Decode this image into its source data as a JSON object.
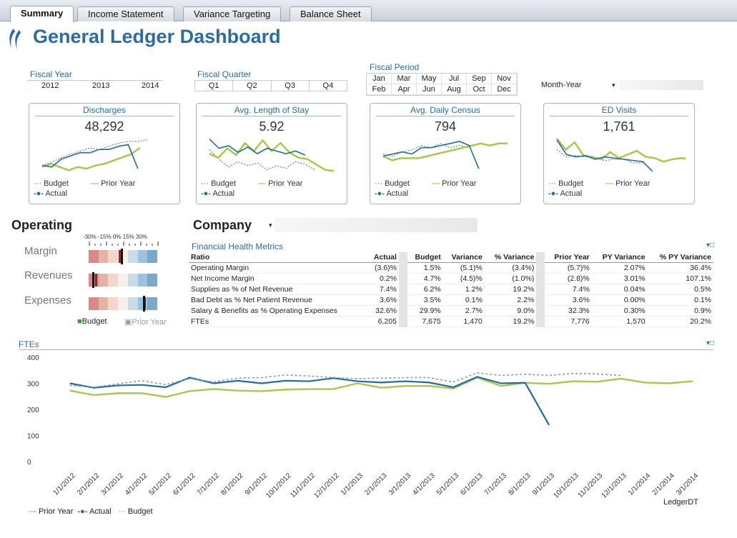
{
  "tabs": [
    {
      "label": "Summary",
      "active": true
    },
    {
      "label": "Income Statement"
    },
    {
      "label": "Variance Targeting"
    },
    {
      "label": "Balance Sheet"
    }
  ],
  "header": {
    "title": "General Ledger Dashboard",
    "accent": "#2b6ca3"
  },
  "filters": {
    "fiscal_year": {
      "label": "Fiscal Year",
      "values": [
        "2012",
        "2013",
        "2014"
      ]
    },
    "fiscal_quarter": {
      "label": "Fiscal Quarter",
      "values": [
        "Q1",
        "Q2",
        "Q3",
        "Q4"
      ]
    },
    "fiscal_period": {
      "label": "Fiscal Period",
      "values": [
        "Jan",
        "Mar",
        "May",
        "Jul",
        "Sep",
        "Nov",
        "Feb",
        "Apr",
        "Jun",
        "Aug",
        "Oct",
        "Dec"
      ]
    },
    "month_year": {
      "label": "Month-Year"
    }
  },
  "kpis": [
    {
      "title": "Discharges",
      "value": "48,292",
      "chart_data": {
        "type": "line",
        "series": [
          {
            "name": "Budget",
            "values": [
              4.1,
              4.3,
              4.6,
              4.8,
              5.0,
              5.2,
              5.1,
              5.3,
              5.5,
              5.6,
              5.6,
              5.7
            ]
          },
          {
            "name": "Prior Year",
            "values": [
              4.0,
              4.2,
              4.0,
              3.8,
              4.0,
              3.9,
              4.1,
              4.2,
              4.4,
              4.6,
              4.8,
              5.2
            ]
          },
          {
            "name": "Actual",
            "values": [
              4.1,
              4.0,
              4.5,
              4.7,
              4.9,
              4.9,
              5.1,
              5.1,
              5.3,
              5.4,
              3.9
            ]
          }
        ]
      }
    },
    {
      "title": "Avg. Length of Stay",
      "value": "5.92",
      "chart_data": {
        "type": "line",
        "series": [
          {
            "name": "Budget",
            "values": [
              4.5,
              3.8,
              3.2,
              3.6,
              3.3,
              3.5,
              3.0,
              3.3,
              3.1,
              3.6,
              3.4,
              3.0
            ]
          },
          {
            "name": "Prior Year",
            "values": [
              4.2,
              3.9,
              4.6,
              4.1,
              5.0,
              4.4,
              5.2,
              4.4,
              5.0,
              4.3,
              3.9,
              3.8,
              3.4,
              3.0,
              2.9
            ]
          },
          {
            "name": "Actual",
            "values": [
              5.3,
              4.6,
              4.8,
              4.3,
              4.7,
              4.2,
              4.6,
              4.4,
              4.2,
              4.4,
              4.1
            ]
          }
        ]
      }
    },
    {
      "title": "Avg. Daily Census",
      "value": "794",
      "chart_data": {
        "type": "line",
        "series": [
          {
            "name": "Budget",
            "values": [
              5.0,
              4.9,
              5.1,
              5.2,
              5.4,
              5.3,
              5.5,
              5.3,
              5.4,
              5.3
            ]
          },
          {
            "name": "Prior Year",
            "values": [
              4.9,
              4.7,
              4.8,
              4.8,
              4.8,
              4.9,
              5.0,
              5.1,
              5.2,
              5.3,
              5.4,
              5.5,
              5.4,
              5.5,
              5.5
            ]
          },
          {
            "name": "Actual",
            "values": [
              4.9,
              5.0,
              5.1,
              5.0,
              5.3,
              5.3,
              5.4,
              5.5,
              5.6,
              5.4,
              4.3
            ]
          }
        ]
      }
    },
    {
      "title": "ED Visits",
      "value": "1,761",
      "chart_data": {
        "type": "line",
        "series": [
          {
            "name": "Budget",
            "values": [
              4.6,
              4.0,
              4.1,
              4.0,
              3.9,
              3.7,
              3.8,
              3.8,
              3.5,
              3.5
            ]
          },
          {
            "name": "Prior Year",
            "values": [
              5.5,
              4.6,
              5.2,
              4.1,
              4.0,
              3.8,
              4.4,
              3.9,
              4.2,
              4.5,
              4.0,
              3.9,
              3.6,
              3.8,
              3.9,
              3.8
            ]
          },
          {
            "name": "Actual",
            "values": [
              5.4,
              4.2,
              4.0,
              4.1,
              3.8,
              4.0,
              3.9,
              3.8,
              3.7,
              3.6,
              2.8
            ]
          }
        ]
      }
    }
  ],
  "kpi_legend": {
    "budget": "Budget",
    "prior": "Prior Year",
    "actual": "Actual"
  },
  "operating": {
    "title": "Operating",
    "scale": [
      "-30%",
      "-15%",
      "0%",
      "15%",
      "30%"
    ],
    "rows": [
      {
        "label": "Margin",
        "budget_pct": -1.5,
        "prior_pct": -3.4
      },
      {
        "label": "Revenues",
        "budget_pct": -26,
        "prior_pct": -24
      },
      {
        "label": "Expenses",
        "budget_pct": 18,
        "prior_pct": 19
      }
    ],
    "legend_budget": "Budget",
    "legend_prior": "Prior Year",
    "colors": [
      "#d88a86",
      "#e4b3a3",
      "#f0d6cc",
      "#f4f0ee",
      "#c6ddec",
      "#9bc3df",
      "#7aa8cc"
    ]
  },
  "company": {
    "label": "Company"
  },
  "fhm": {
    "title": "Financial Health Metrics",
    "headers": [
      "Ratio",
      "Actual",
      "Budget",
      "Variance",
      "% Variance",
      "Prior Year",
      "PY Variance",
      "% PY Variance"
    ],
    "rows": [
      [
        "Operating Margin",
        "(3.6)%",
        "1.5%",
        "(5.1)%",
        "(3.4%)",
        "(5.7)%",
        "2.07%",
        "36.4%"
      ],
      [
        "Net Income Margin",
        "0.2%",
        "4.7%",
        "(4.5)%",
        "(1.0%)",
        "(2.8)%",
        "3.01%",
        "107.1%"
      ],
      [
        "Supplies as % of Net Revenue",
        "7.4%",
        "6.2%",
        "1.2%",
        "19.2%",
        "7.4%",
        "0.04%",
        "0.5%"
      ],
      [
        "Bad Debt as % Net Patient Revenue",
        "3.6%",
        "3.5%",
        "0.1%",
        "2.2%",
        "3.6%",
        "0.00%",
        "0.1%"
      ],
      [
        "Salary & Benefits as % Operating Expenses",
        "32.6%",
        "29.9%",
        "2.7%",
        "9.0%",
        "32.3%",
        "0.30%",
        "0.9%"
      ],
      [
        "FTEs",
        "6,205",
        "7,675",
        "1,470",
        "19.2%",
        "7,776",
        "1,570",
        "20.2%"
      ]
    ]
  },
  "ftes": {
    "title": "FTEs",
    "xlabel": "LedgerDT",
    "chart_data": {
      "type": "line",
      "x": [
        "1/1/2012",
        "2/1/2012",
        "3/1/2012",
        "4/1/2012",
        "5/1/2012",
        "6/1/2012",
        "7/1/2012",
        "8/1/2012",
        "9/1/2012",
        "10/1/2012",
        "11/1/2012",
        "12/1/2012",
        "1/1/2013",
        "2/1/2013",
        "3/1/2013",
        "4/1/2013",
        "5/1/2013",
        "6/1/2013",
        "7/1/2013",
        "8/1/2013",
        "9/1/2013",
        "10/1/2013",
        "11/1/2013",
        "12/1/2013",
        "1/1/2014",
        "2/1/2014",
        "3/1/2014"
      ],
      "ylim": [
        0,
        400
      ],
      "yticks": [
        0,
        100,
        200,
        300,
        400
      ],
      "series": [
        {
          "name": "Prior Year",
          "color": "#a6c94a",
          "values": [
            272,
            255,
            262,
            262,
            248,
            270,
            278,
            272,
            270,
            276,
            278,
            278,
            300,
            283,
            290,
            290,
            280,
            322,
            290,
            302,
            298,
            308,
            306,
            318,
            303,
            300,
            308
          ]
        },
        {
          "name": "Actual",
          "color": "#236c9e",
          "values": [
            300,
            283,
            292,
            294,
            285,
            322,
            300,
            310,
            300,
            310,
            308,
            320,
            308,
            303,
            308,
            303,
            285,
            325,
            300,
            302,
            140
          ]
        },
        {
          "name": "Budget",
          "color": "#7a9fc0",
          "values": [
            292,
            285,
            298,
            310,
            295,
            318,
            305,
            320,
            322,
            332,
            328,
            322,
            318,
            320,
            322,
            322,
            305,
            340,
            330,
            335,
            330,
            338,
            336,
            330
          ]
        }
      ]
    }
  }
}
